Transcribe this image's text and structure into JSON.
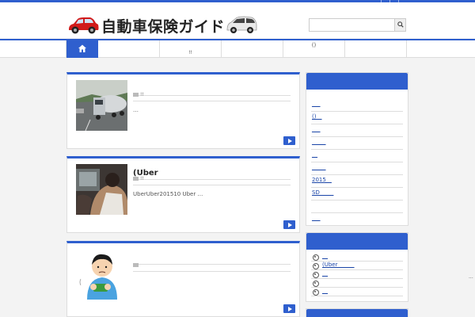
{
  "site": {
    "title": "自動車保険ガイド",
    "search_placeholder": "",
    "search_icon": "magnifier-icon"
  },
  "nav": {
    "items": [
      {
        "label": "",
        "sub": "",
        "icon": "home-icon"
      },
      {
        "label": "",
        "sub": ""
      },
      {
        "label": "",
        "sub": "!!"
      },
      {
        "label": "",
        "sub": ""
      },
      {
        "label": "()",
        "sub": ""
      },
      {
        "label": "",
        "sub": ""
      }
    ]
  },
  "posts": [
    {
      "title": "",
      "meta": "!!",
      "excerpt": "…",
      "thumb": "tanker-truck-photo"
    },
    {
      "title": "(Uber",
      "meta": "!!",
      "excerpt": "UberUber201510 Uber …",
      "thumb": "taxi-driver-photo"
    },
    {
      "title": "",
      "meta": "",
      "excerpt": "",
      "thumb": "worried-man-illustration"
    }
  ],
  "sidebar": {
    "list_a": [
      "___",
      "()__",
      "___",
      "_____",
      "__",
      "_____",
      "2015__",
      "SD_____",
      "",
      "___"
    ],
    "list_b": [
      "__",
      "(Uber______",
      "__",
      "",
      "__"
    ]
  },
  "colors": {
    "accent": "#2f5fce",
    "background": "#f3f3f3"
  }
}
